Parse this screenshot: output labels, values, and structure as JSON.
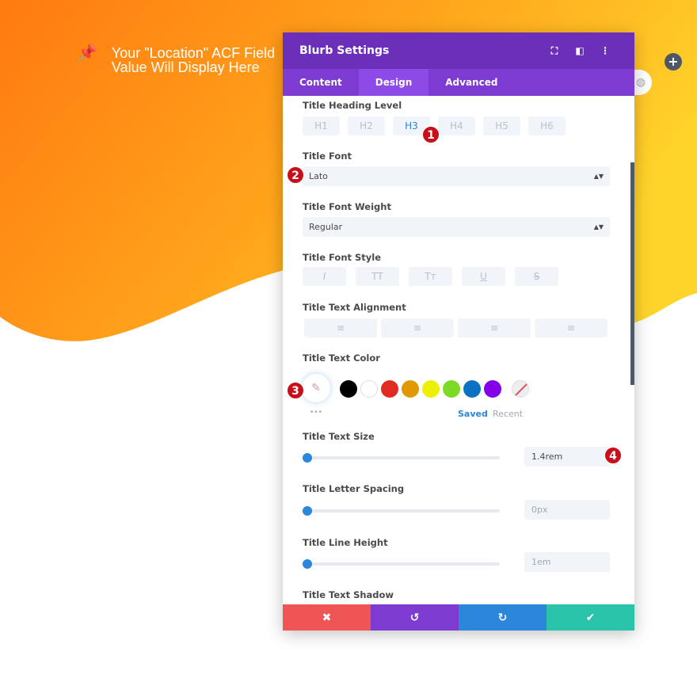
{
  "hero": {
    "pin_icon": "pushpin-icon",
    "text_line1": "Your \"Location\" ACF Field",
    "text_line2": "Value Will Display Here"
  },
  "panel": {
    "title": "Blurb Settings",
    "tabs": [
      {
        "label": "Content"
      },
      {
        "label": "Design",
        "active": true
      },
      {
        "label": "Advanced"
      }
    ]
  },
  "heading": {
    "label": "Title Heading Level",
    "levels": [
      "H1",
      "H2",
      "H3",
      "H4",
      "H5",
      "H6"
    ],
    "selected": "H3"
  },
  "font": {
    "label": "Title Font",
    "value": "Lato"
  },
  "weight": {
    "label": "Title Font Weight",
    "value": "Regular"
  },
  "style": {
    "label": "Title Font Style",
    "options": [
      "I",
      "TT",
      "Tт",
      "U",
      "S"
    ]
  },
  "align": {
    "label": "Title Text Alignment",
    "options": [
      "left",
      "center",
      "right",
      "justify"
    ]
  },
  "color": {
    "label": "Title Text Color",
    "swatches": [
      "#000000",
      "#ffffff",
      "#e02b20",
      "#e09900",
      "#edf000",
      "#7cda24",
      "#0c71c3",
      "#8300e9"
    ],
    "saved": "Saved",
    "recent": "Recent",
    "more": "•••"
  },
  "size": {
    "label": "Title Text Size",
    "value": "1.4rem"
  },
  "spacing": {
    "label": "Title Letter Spacing",
    "value": "0px"
  },
  "lineheight": {
    "label": "Title Line Height",
    "value": "1em"
  },
  "shadow": {
    "label": "Title Text Shadow"
  },
  "badges": [
    "1",
    "2",
    "3",
    "4"
  ],
  "footer": {
    "cancel": "✖",
    "undo": "↺",
    "redo": "↻",
    "save": "✔"
  },
  "colors": {
    "header": "#6b2fba",
    "tabs": "#7d3bd1",
    "cancel": "#ef5555",
    "undo": "#7e3bd0",
    "redo": "#2b87da",
    "save": "#29c4a9"
  }
}
